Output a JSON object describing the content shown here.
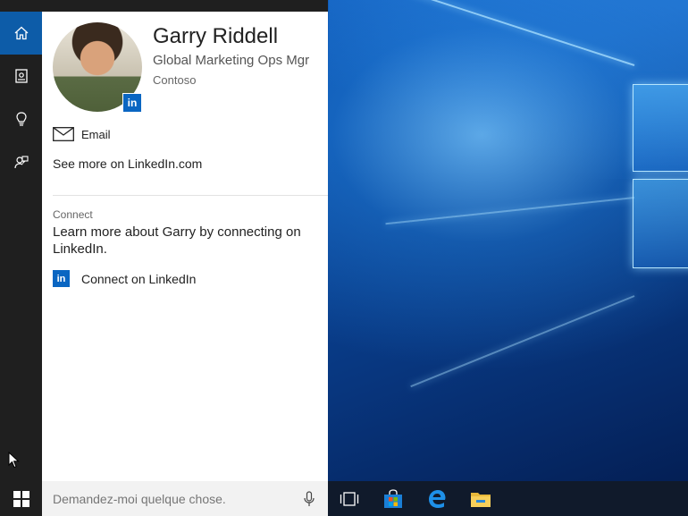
{
  "rail": {
    "items": [
      {
        "icon": "home-icon",
        "active": true
      },
      {
        "icon": "notebook-icon",
        "active": false
      },
      {
        "icon": "lightbulb-icon",
        "active": false
      },
      {
        "icon": "feedback-icon",
        "active": false
      }
    ]
  },
  "profile": {
    "name": "Garry Riddell",
    "job_title": "Global Marketing Ops Mgr",
    "company": "Contoso",
    "badge_text": "in"
  },
  "actions": {
    "email_label": "Email",
    "see_more_label": "See more on LinkedIn.com"
  },
  "connect": {
    "heading": "Connect",
    "description": "Learn more about Garry by connecting on LinkedIn.",
    "button_label": "Connect on LinkedIn",
    "icon_text": "in"
  },
  "search": {
    "placeholder": "Demandez-moi quelque chose."
  },
  "taskbar": {
    "icons": [
      "windows-start-icon",
      "task-view-icon",
      "store-icon",
      "edge-icon",
      "file-explorer-icon"
    ]
  },
  "colors": {
    "accent": "#0d5ca8",
    "linkedin": "#0a66c2",
    "rail": "#1f1f1f",
    "taskbar": "#101a2b"
  }
}
